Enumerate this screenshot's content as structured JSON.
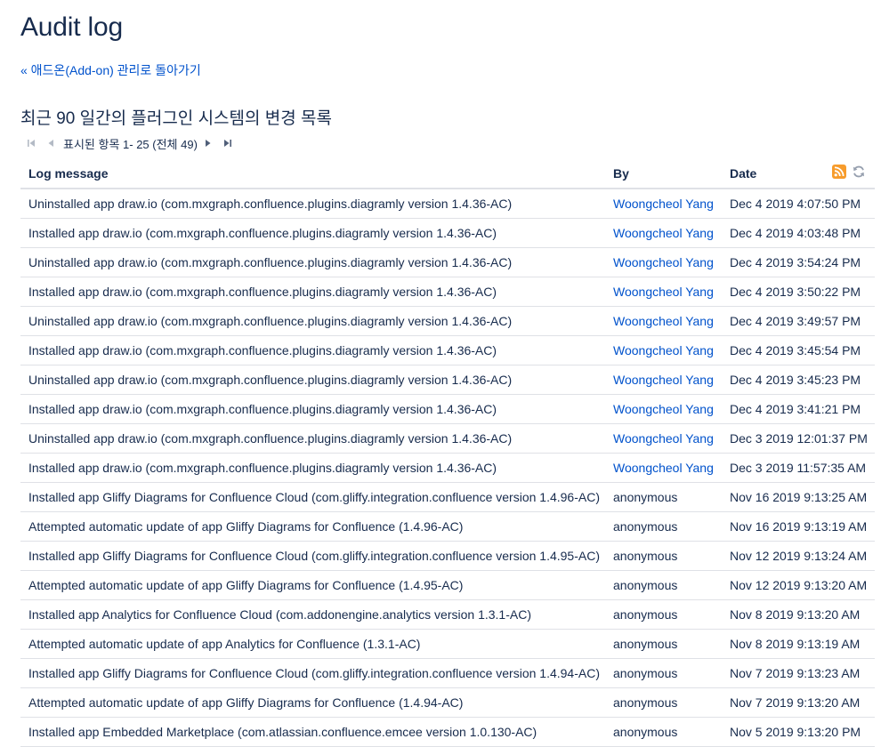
{
  "page": {
    "title": "Audit log",
    "back_link": "« 애드온(Add-on) 관리로 돌아가기",
    "subtitle": "최근 90 일간의 플러그인 시스템의 변경 목록"
  },
  "pager": {
    "text": "표시된 항목 1- 25 (전체 49)",
    "first_icon": "first-page-icon",
    "prev_icon": "previous-page-icon",
    "next_icon": "next-page-icon",
    "last_icon": "last-page-icon"
  },
  "table": {
    "columns": {
      "message": "Log message",
      "by": "By",
      "date": "Date"
    },
    "header_icons": [
      "rss-feed-icon",
      "refresh-icon"
    ],
    "rows": [
      {
        "message": "Uninstalled app draw.io (com.mxgraph.confluence.plugins.diagramly version 1.4.36-AC)",
        "by": "Woongcheol Yang",
        "by_link": true,
        "date": "Dec 4 2019 4:07:50 PM"
      },
      {
        "message": "Installed app draw.io (com.mxgraph.confluence.plugins.diagramly version 1.4.36-AC)",
        "by": "Woongcheol Yang",
        "by_link": true,
        "date": "Dec 4 2019 4:03:48 PM"
      },
      {
        "message": "Uninstalled app draw.io (com.mxgraph.confluence.plugins.diagramly version 1.4.36-AC)",
        "by": "Woongcheol Yang",
        "by_link": true,
        "date": "Dec 4 2019 3:54:24 PM"
      },
      {
        "message": "Installed app draw.io (com.mxgraph.confluence.plugins.diagramly version 1.4.36-AC)",
        "by": "Woongcheol Yang",
        "by_link": true,
        "date": "Dec 4 2019 3:50:22 PM"
      },
      {
        "message": "Uninstalled app draw.io (com.mxgraph.confluence.plugins.diagramly version 1.4.36-AC)",
        "by": "Woongcheol Yang",
        "by_link": true,
        "date": "Dec 4 2019 3:49:57 PM"
      },
      {
        "message": "Installed app draw.io (com.mxgraph.confluence.plugins.diagramly version 1.4.36-AC)",
        "by": "Woongcheol Yang",
        "by_link": true,
        "date": "Dec 4 2019 3:45:54 PM"
      },
      {
        "message": "Uninstalled app draw.io (com.mxgraph.confluence.plugins.diagramly version 1.4.36-AC)",
        "by": "Woongcheol Yang",
        "by_link": true,
        "date": "Dec 4 2019 3:45:23 PM"
      },
      {
        "message": "Installed app draw.io (com.mxgraph.confluence.plugins.diagramly version 1.4.36-AC)",
        "by": "Woongcheol Yang",
        "by_link": true,
        "date": "Dec 4 2019 3:41:21 PM"
      },
      {
        "message": "Uninstalled app draw.io (com.mxgraph.confluence.plugins.diagramly version 1.4.36-AC)",
        "by": "Woongcheol Yang",
        "by_link": true,
        "date": "Dec 3 2019 12:01:37 PM"
      },
      {
        "message": "Installed app draw.io (com.mxgraph.confluence.plugins.diagramly version 1.4.36-AC)",
        "by": "Woongcheol Yang",
        "by_link": true,
        "date": "Dec 3 2019 11:57:35 AM"
      },
      {
        "message": "Installed app Gliffy Diagrams for Confluence Cloud (com.gliffy.integration.confluence version 1.4.96-AC)",
        "by": "anonymous",
        "by_link": false,
        "date": "Nov 16 2019 9:13:25 AM"
      },
      {
        "message": "Attempted automatic update of app Gliffy Diagrams for Confluence (1.4.96-AC)",
        "by": "anonymous",
        "by_link": false,
        "date": "Nov 16 2019 9:13:19 AM"
      },
      {
        "message": "Installed app Gliffy Diagrams for Confluence Cloud (com.gliffy.integration.confluence version 1.4.95-AC)",
        "by": "anonymous",
        "by_link": false,
        "date": "Nov 12 2019 9:13:24 AM"
      },
      {
        "message": "Attempted automatic update of app Gliffy Diagrams for Confluence (1.4.95-AC)",
        "by": "anonymous",
        "by_link": false,
        "date": "Nov 12 2019 9:13:20 AM"
      },
      {
        "message": "Installed app Analytics for Confluence Cloud (com.addonengine.analytics version 1.3.1-AC)",
        "by": "anonymous",
        "by_link": false,
        "date": "Nov 8 2019 9:13:20 AM"
      },
      {
        "message": "Attempted automatic update of app Analytics for Confluence (1.3.1-AC)",
        "by": "anonymous",
        "by_link": false,
        "date": "Nov 8 2019 9:13:19 AM"
      },
      {
        "message": "Installed app Gliffy Diagrams for Confluence Cloud (com.gliffy.integration.confluence version 1.4.94-AC)",
        "by": "anonymous",
        "by_link": false,
        "date": "Nov 7 2019 9:13:23 AM"
      },
      {
        "message": "Attempted automatic update of app Gliffy Diagrams for Confluence (1.4.94-AC)",
        "by": "anonymous",
        "by_link": false,
        "date": "Nov 7 2019 9:13:20 AM"
      },
      {
        "message": "Installed app Embedded Marketplace (com.atlassian.confluence.emcee version 1.0.130-AC)",
        "by": "anonymous",
        "by_link": false,
        "date": "Nov 5 2019 9:13:20 PM"
      }
    ]
  },
  "colors": {
    "link": "#0052cc",
    "text": "#172b4d",
    "rss": "#f79c2c",
    "border": "#dfe1e6"
  }
}
